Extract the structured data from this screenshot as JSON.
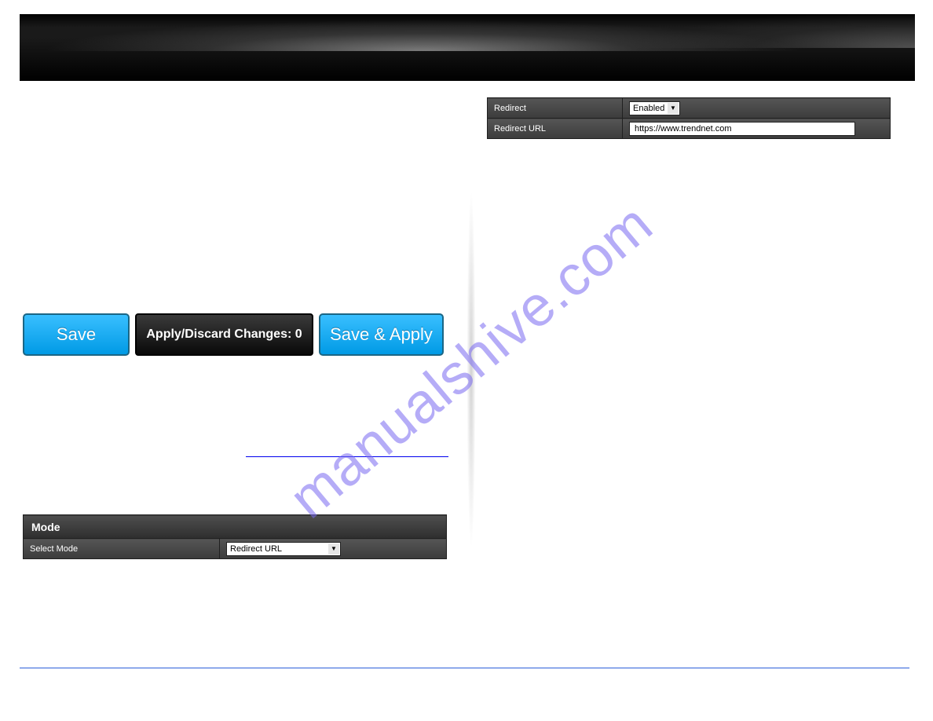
{
  "watermark": "manualshive.com",
  "config": {
    "redirect_label": "Redirect",
    "redirect_value": "Enabled",
    "url_label": "Redirect URL",
    "url_value": "https://www.trendnet.com"
  },
  "actions": {
    "save": "Save",
    "status": "Apply/Discard Changes: 0",
    "save_apply": "Save & Apply"
  },
  "mode": {
    "header": "Mode",
    "select_label": "Select Mode",
    "select_value": "Redirect URL"
  }
}
